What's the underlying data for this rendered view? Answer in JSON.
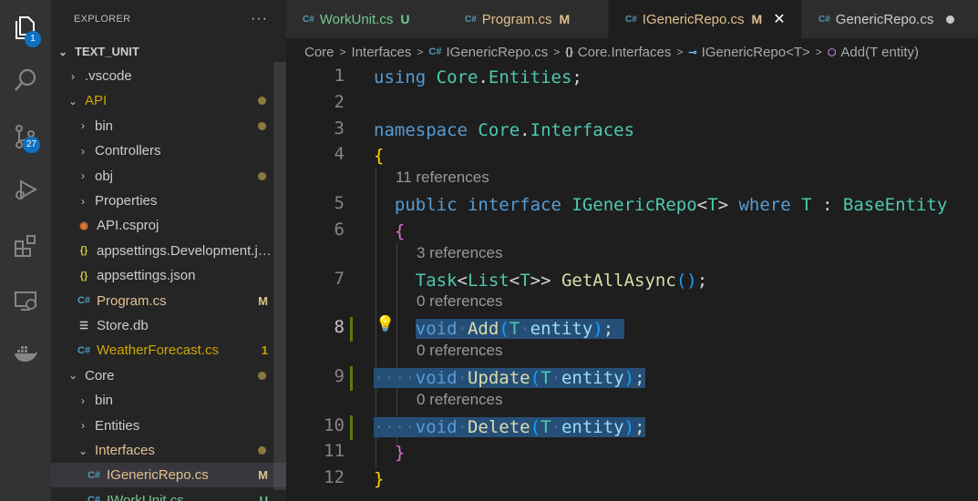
{
  "activity_bar": {
    "explorer_badge": "1",
    "scm_badge": "27"
  },
  "sidebar": {
    "title": "EXPLORER",
    "more": "···",
    "root": "TEXT_UNIT",
    "items": [
      {
        "label": ".vscode",
        "kind": "folder",
        "open": false,
        "color": "#cccccc",
        "deco": ""
      },
      {
        "label": "API",
        "kind": "folder",
        "open": true,
        "color": "#cca700",
        "deco": "dot"
      },
      {
        "label": "bin",
        "kind": "folder",
        "open": false,
        "color": "#cccccc",
        "deco": "dot"
      },
      {
        "label": "Controllers",
        "kind": "folder",
        "open": false,
        "color": "#cccccc",
        "deco": ""
      },
      {
        "label": "obj",
        "kind": "folder",
        "open": false,
        "color": "#cccccc",
        "deco": "dot"
      },
      {
        "label": "Properties",
        "kind": "folder",
        "open": false,
        "color": "#cccccc",
        "deco": ""
      },
      {
        "label": "API.csproj",
        "kind": "rss",
        "color": "#cccccc",
        "deco": ""
      },
      {
        "label": "appsettings.Development.json",
        "kind": "json",
        "color": "#cccccc",
        "deco": ""
      },
      {
        "label": "appsettings.json",
        "kind": "json",
        "color": "#cccccc",
        "deco": ""
      },
      {
        "label": "Program.cs",
        "kind": "cs",
        "color": "#e2c08d",
        "deco": "M"
      },
      {
        "label": "Store.db",
        "kind": "db",
        "color": "#cccccc",
        "deco": ""
      },
      {
        "label": "WeatherForecast.cs",
        "kind": "cs",
        "color": "#cca700",
        "deco": "1"
      },
      {
        "label": "Core",
        "kind": "folder",
        "open": true,
        "color": "#cccccc",
        "deco": "dot"
      },
      {
        "label": "bin",
        "kind": "folder",
        "open": false,
        "color": "#cccccc",
        "deco": ""
      },
      {
        "label": "Entities",
        "kind": "folder",
        "open": false,
        "color": "#cccccc",
        "deco": ""
      },
      {
        "label": "Interfaces",
        "kind": "folder",
        "open": true,
        "color": "#e2c08d",
        "deco": "dot"
      },
      {
        "label": "IGenericRepo.cs",
        "kind": "cs",
        "color": "#e2c08d",
        "deco": "M",
        "selected": true
      },
      {
        "label": "IWorkUnit.cs",
        "kind": "cs",
        "color": "#73c991",
        "deco": "U"
      }
    ]
  },
  "tabs": [
    {
      "label": "WorkUnit.cs",
      "status": "U",
      "color": "#73c991",
      "active": false
    },
    {
      "label": "Program.cs",
      "status": "M",
      "color": "#e2c08d",
      "active": false
    },
    {
      "label": "IGenericRepo.cs",
      "status": "M",
      "color": "#e2c08d",
      "active": true,
      "close": "✕"
    },
    {
      "label": "GenericRepo.cs",
      "status": "",
      "color": "#cccccc",
      "active": false
    }
  ],
  "breadcrumbs": {
    "p1": "Core",
    "p2": "Interfaces",
    "p3": "IGenericRepo.cs",
    "p4": "Core.Interfaces",
    "p5": "IGenericRepo<T>",
    "p6": "Add(T entity)"
  },
  "code": {
    "line_numbers": [
      "1",
      "2",
      "3",
      "4",
      "5",
      "6",
      "7",
      "8",
      "9",
      "10",
      "11",
      "12"
    ],
    "lens_11": "11 references",
    "lens_3": "3 references",
    "lens_0a": "0 references",
    "lens_0b": "0 references",
    "lens_0c": "0 references"
  }
}
